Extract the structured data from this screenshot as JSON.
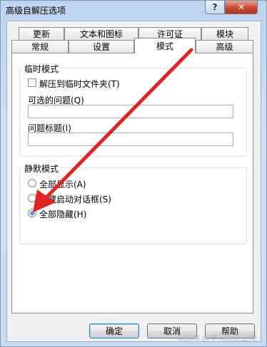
{
  "window": {
    "title": "高级自解压选项",
    "help_label": "?",
    "close_label": "✕"
  },
  "tabs": {
    "row_back": [
      "更新",
      "文本和图标",
      "许可证",
      "模块"
    ],
    "row_front": [
      "常规",
      "设置",
      "模式",
      "高级"
    ],
    "active": "模式"
  },
  "temp_mode": {
    "group_title": "临时模式",
    "unpack_to_temp_label": "解压到临时文件夹(T)",
    "unpack_to_temp_checked": false,
    "optional_question_label": "可选的问题(Q)",
    "optional_question_value": "",
    "question_title_label": "问题标题(I)",
    "question_title_value": ""
  },
  "silent_mode": {
    "group_title": "静默模式",
    "options": [
      "全部显示(A)",
      "隐藏启动对话框(S)",
      "全部隐藏(H)"
    ],
    "selected": "全部隐藏(H)"
  },
  "buttons": {
    "ok": "确定",
    "cancel": "取消",
    "help": "帮助"
  },
  "watermark": "CSDN @学习永无止境",
  "colors": {
    "arrow": "#e02424",
    "radio_selected": "#1a5fb4"
  }
}
